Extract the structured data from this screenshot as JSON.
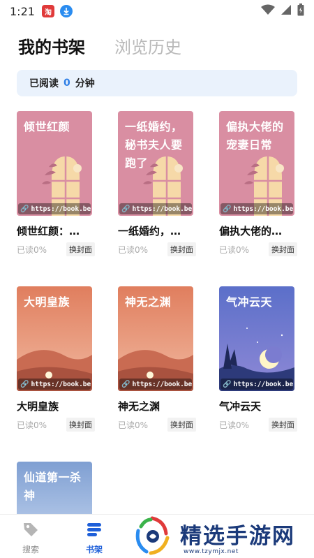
{
  "status_bar": {
    "time": "1:21",
    "notif1": "淘"
  },
  "tabs": {
    "bookshelf": "我的书架",
    "history": "浏览历史"
  },
  "reading": {
    "prefix": "已阅读",
    "minutes": "0",
    "suffix": "分钟"
  },
  "cover_url": "https://book.befu",
  "change_cover_label": "换封面",
  "books": [
    {
      "title": "倾世红颜：…",
      "cover_title": "倾世红颜",
      "progress": "已读0%"
    },
    {
      "title": "一纸婚约，…",
      "cover_title": "一纸婚约，秘书夫人要跑了",
      "progress": "已读0%"
    },
    {
      "title": "偏执大佬的…",
      "cover_title": "偏执大佬的宠妻日常",
      "progress": "已读0%"
    },
    {
      "title": "大明皇族",
      "cover_title": "大明皇族",
      "progress": "已读0%"
    },
    {
      "title": "神无之渊",
      "cover_title": "神无之渊",
      "progress": "已读0%"
    },
    {
      "title": "气冲云天",
      "cover_title": "气冲云天",
      "progress": "已读0%"
    },
    {
      "cover_title": "仙道第一杀神"
    }
  ],
  "nav": {
    "search": "搜索",
    "bookshelf": "书架"
  },
  "watermark": {
    "text": "精选手游网",
    "url": "www.tzymjx.net"
  },
  "colors": {
    "accent": "#1e5fd9",
    "pink_cover": "#d98ea2",
    "desert_cover": "#e58a64",
    "night_cover": "#5b6fc9",
    "blue_cover": "#7f9fd2"
  }
}
